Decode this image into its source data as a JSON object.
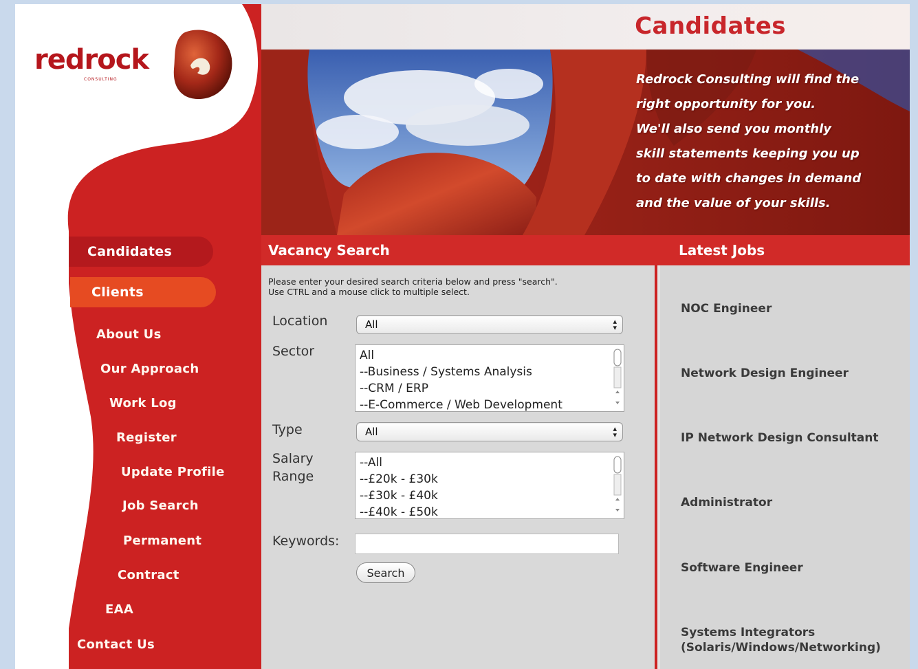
{
  "colors": {
    "brand_red": "#cc2222",
    "dark_red": "#b4191d",
    "orange": "#e64b22",
    "panel_gray": "#d9d9d9"
  },
  "logo": {
    "word": "redrock",
    "tagline": "CONSULTING",
    "mark_icon": "red-rock-logo-icon"
  },
  "header": {
    "title": "Candidates"
  },
  "hero": {
    "lines": [
      "Redrock Consulting will find the",
      "right opportunity for you.",
      "We'll also send you monthly",
      "skill statements keeping you up",
      "to date with changes in demand",
      "and the value of your skills."
    ]
  },
  "nav": {
    "candidates": "Candidates",
    "clients": "Clients",
    "links": [
      "About Us",
      "Our Approach",
      "Work Log",
      "Register",
      "Update Profile",
      "Job Search",
      "Permanent",
      "Contract",
      "EAA",
      "Contact Us"
    ]
  },
  "vacancy_search": {
    "title": "Vacancy Search",
    "instructions": [
      "Please enter your desired search criteria below and press \"search\".",
      "Use CTRL and a mouse click to multiple select."
    ],
    "location_label": "Location",
    "location_value": "All",
    "sector_label": "Sector",
    "sector_options": [
      "All",
      "--Business / Systems Analysis",
      "--CRM / ERP",
      "--E-Commerce / Web Development"
    ],
    "type_label": "Type",
    "type_value": "All",
    "salary_label_1": "Salary",
    "salary_label_2": "Range",
    "salary_options": [
      "--All",
      "--£20k - £30k",
      "--£30k - £40k",
      "--£40k - £50k"
    ],
    "keywords_label": "Keywords:",
    "keywords_value": "",
    "search_button": "Search"
  },
  "latest_jobs": {
    "title": "Latest Jobs",
    "jobs": [
      "NOC Engineer",
      "Network Design Engineer",
      "IP Network Design Consultant",
      "Administrator",
      "Software Engineer",
      "Systems Integrators",
      "(Solaris/Windows/Networking)"
    ]
  }
}
